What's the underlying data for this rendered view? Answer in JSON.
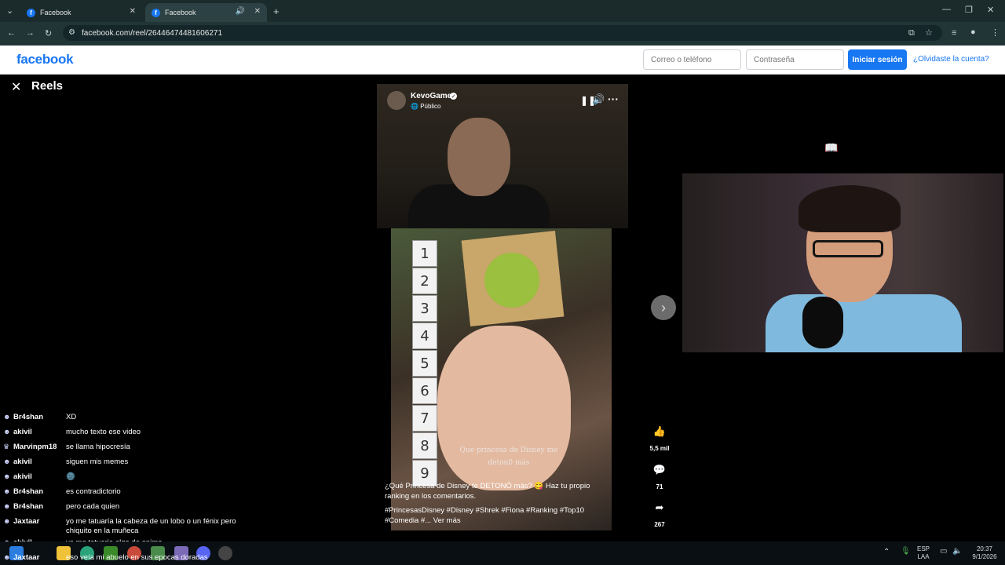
{
  "browser": {
    "tabs": [
      {
        "label": "Facebook",
        "active": false
      },
      {
        "label": "Facebook",
        "active": true
      }
    ],
    "url": "facebook.com/reel/264464744816062​71"
  },
  "fb_header": {
    "logo": "facebook",
    "email_placeholder": "Correo o teléfono",
    "password_placeholder": "Contraseña",
    "login_label": "Iniciar sesión",
    "forgot_label": "¿Olvidaste la cuenta?"
  },
  "reels": {
    "title": "Reels",
    "author": "KevoGame",
    "audience": "Público",
    "caption": "¿Qué Princesa de Disney te DETONÓ más? 😋 Haz tu propio ranking en los comentarios.",
    "hashtags": "#PrincesasDisney #Disney #Shrek #Fiona #Ranking #Top10 #Comedia #... Ver más",
    "overlay_text": "Que princesa de Disney me deton0 más",
    "rank_numbers": [
      "1",
      "2",
      "3",
      "4",
      "5",
      "6",
      "7",
      "8",
      "9"
    ],
    "likes": "5,5 mil",
    "comments": "71",
    "shares": "267"
  },
  "chat": [
    {
      "user": "Br4shan",
      "msg": "XD"
    },
    {
      "user": "akivil",
      "msg": "mucho texto ese video"
    },
    {
      "user": "Marvinpm18",
      "msg": "se llama hipocresía"
    },
    {
      "user": "akivil",
      "msg": "siguen mis memes"
    },
    {
      "user": "akivil",
      "msg": "🌚"
    },
    {
      "user": "Br4shan",
      "msg": "es contradictorio"
    },
    {
      "user": "Br4shan",
      "msg": "pero cada quien"
    },
    {
      "user": "Jaxtaar",
      "msg": "yo me tatuaría la cabeza de un lobo o un fénix pero chiquito en la muñeca"
    },
    {
      "user": "akivil",
      "msg": "yo me tatuaria algo de anime"
    },
    {
      "user": "Jaxtaar",
      "msg": "eso veía mi abuelo en sus epocas doradas"
    }
  ],
  "taskbar": {
    "lang_top": "ESP",
    "lang_bottom": "LAA",
    "time": "20:37",
    "date": "9/1/2026"
  },
  "colors": {
    "fb_blue": "#1877f2",
    "chrome_bg": "#1b2b2c"
  }
}
